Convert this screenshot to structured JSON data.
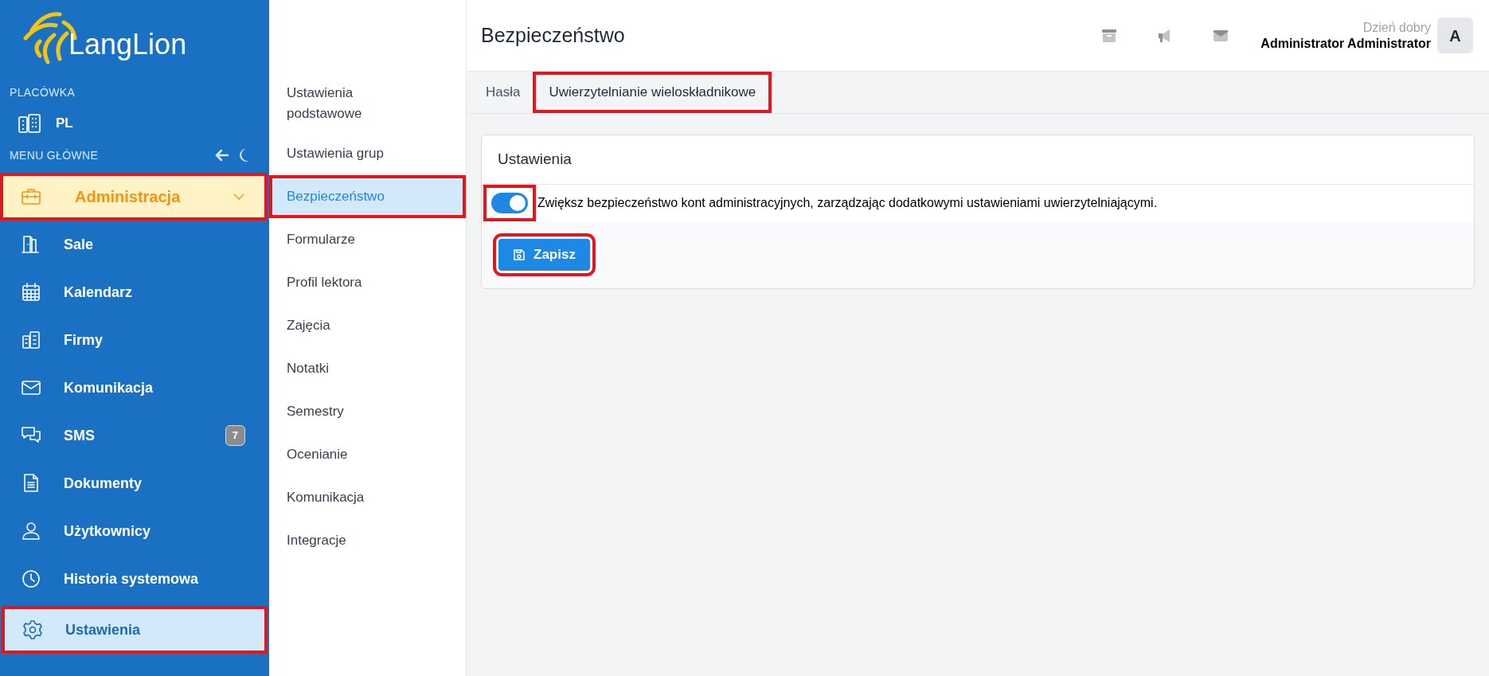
{
  "logo": {
    "text": "LangLion"
  },
  "sidebar": {
    "branch_label": "PLACÓWKA",
    "branch": "PL",
    "menu_label": "MENU GŁÓWNE",
    "items": [
      {
        "kind": "group",
        "label": "Administracja",
        "selected": true,
        "highlighted": true,
        "expanded": false
      },
      {
        "kind": "item",
        "label": "Sale",
        "selected": false,
        "highlighted": false
      },
      {
        "kind": "item",
        "label": "Kalendarz",
        "selected": false,
        "highlighted": false
      },
      {
        "kind": "item",
        "label": "Firmy",
        "selected": false,
        "highlighted": false
      },
      {
        "kind": "item",
        "label": "Komunikacja",
        "selected": false,
        "highlighted": false
      },
      {
        "kind": "item",
        "label": "SMS",
        "badge": "7",
        "selected": false,
        "highlighted": false
      },
      {
        "kind": "item",
        "label": "Dokumenty",
        "selected": false,
        "highlighted": false
      },
      {
        "kind": "item",
        "label": "Użytkownicy",
        "selected": false,
        "highlighted": false
      },
      {
        "kind": "item",
        "label": "Historia systemowa",
        "selected": false,
        "highlighted": false
      },
      {
        "kind": "item",
        "label": "Ustawienia",
        "selected": true,
        "highlighted": true
      }
    ]
  },
  "settings_nav": [
    {
      "label": "Ustawienia podstawowe",
      "selected": false,
      "highlighted": false
    },
    {
      "label": "Ustawienia grup",
      "selected": false,
      "highlighted": false
    },
    {
      "label": "Bezpieczeństwo",
      "selected": true,
      "highlighted": true
    },
    {
      "label": "Formularze",
      "selected": false,
      "highlighted": false
    },
    {
      "label": "Profil lektora",
      "selected": false,
      "highlighted": false
    },
    {
      "label": "Zajęcia",
      "selected": false,
      "highlighted": false
    },
    {
      "label": "Notatki",
      "selected": false,
      "highlighted": false
    },
    {
      "label": "Semestry",
      "selected": false,
      "highlighted": false
    },
    {
      "label": "Ocenianie",
      "selected": false,
      "highlighted": false
    },
    {
      "label": "Komunikacja",
      "selected": false,
      "highlighted": false
    },
    {
      "label": "Integracje",
      "selected": false,
      "highlighted": false
    }
  ],
  "header": {
    "title": "Bezpieczeństwo",
    "greeting": "Dzień dobry",
    "user_name": "Administrator Administrator",
    "avatar": "A"
  },
  "tabs": [
    {
      "label": "Hasła",
      "selected": false,
      "highlighted": false
    },
    {
      "label": "Uwierzytelnianie wieloskładnikowe",
      "selected": true,
      "highlighted": true
    }
  ],
  "card": {
    "title": "Ustawienia",
    "toggle": {
      "on": true,
      "highlighted": true,
      "label": "Zwiększ bezpieczeństwo kont administracyjnych, zarządzając dodatkowymi ustawieniami uwierzytelniającymi."
    },
    "save_button": {
      "label": "Zapisz",
      "highlighted": true
    }
  }
}
